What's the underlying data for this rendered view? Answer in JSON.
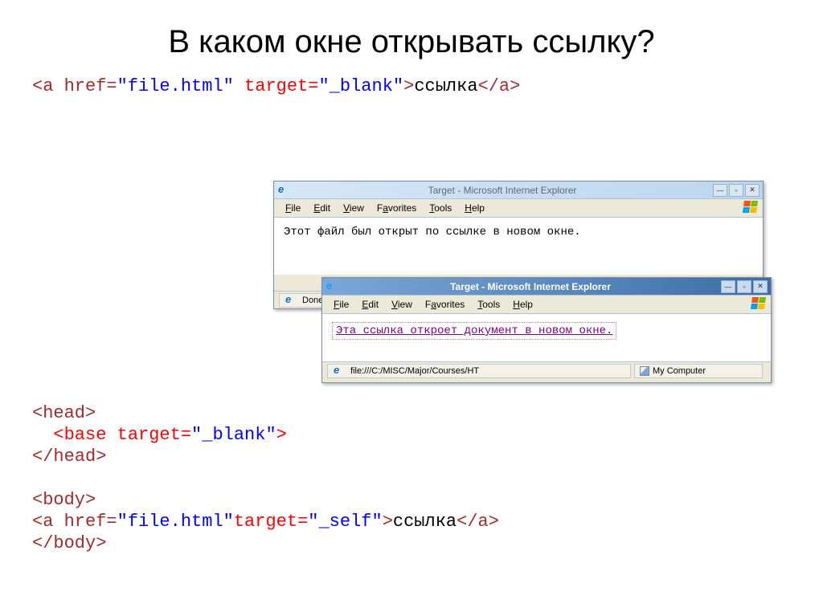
{
  "title": "В каком окне открывать ссылку?",
  "code1": {
    "p1": "<a href=",
    "p2": "\"file.html\"",
    "p3": " target=",
    "p4": "\"_blank\"",
    "p5": ">",
    "p6": "ссылка",
    "p7": "</a>"
  },
  "win1": {
    "title": "Target - Microsoft Internet Explorer",
    "content": "Этот файл был открыт по ссылке в новом окне.",
    "status_done": "Done"
  },
  "win2": {
    "title": "Target - Microsoft Internet Explorer",
    "content": "Эта ссылка откроет документ в новом окне.",
    "status_url": "file:///C:/MISC/Major/Courses/HT",
    "status_right": "My Computer"
  },
  "menu": {
    "file": "File",
    "edit": "Edit",
    "view": "View",
    "favorites": "Favorites",
    "tools": "Tools",
    "help": "Help"
  },
  "code2": {
    "l1": "<head>",
    "l2a": "  <base target=",
    "l2b": "\"_blank\"",
    "l2c": ">",
    "l3": "</head>",
    "l4": "",
    "l5": "<body>",
    "l6a": "<a href=",
    "l6b": "\"file.html\"",
    "l6c": "target=",
    "l6d": "\"_self\"",
    "l6e": ">",
    "l6f": "ссылка",
    "l6g": "</a>",
    "l7": "</body>"
  }
}
